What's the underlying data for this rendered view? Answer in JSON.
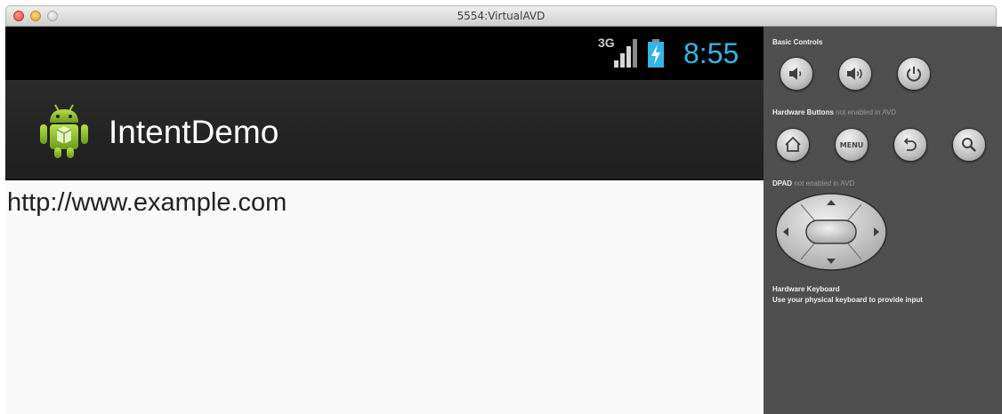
{
  "window": {
    "title": "5554:VirtualAVD"
  },
  "status_bar": {
    "network_type": "3G",
    "time": "8:55",
    "clock_color": "#33b5e5"
  },
  "action_bar": {
    "app_title": "IntentDemo",
    "icon": "android-robot-icon"
  },
  "content": {
    "text": "http://www.example.com"
  },
  "controls": {
    "basic_label": "Basic Controls",
    "hardware_buttons_label": "Hardware Buttons",
    "hardware_buttons_note": "not enabled in AVD",
    "menu_label": "MENU",
    "dpad_label": "DPAD",
    "dpad_note": "not enabled in AVD",
    "keyboard_label": "Hardware Keyboard",
    "keyboard_note": "Use your physical keyboard to provide input"
  }
}
